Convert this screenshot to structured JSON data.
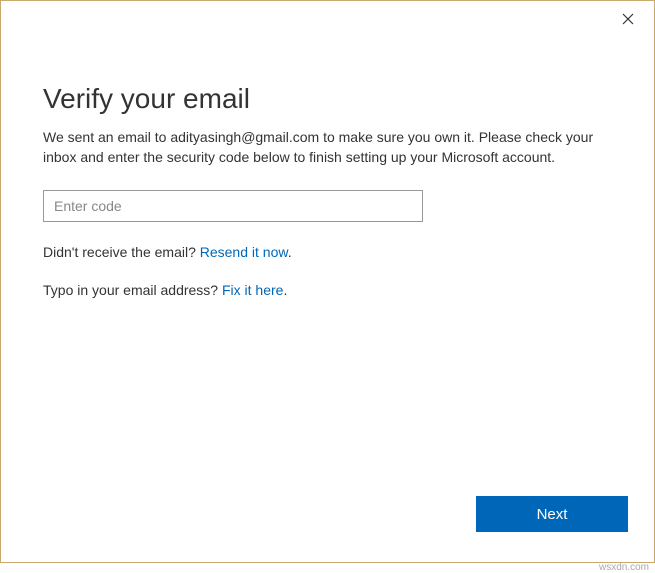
{
  "title": "Verify your email",
  "description": "We sent an email to adityasingh@gmail.com to make sure you own it. Please check your inbox and enter the security code below to finish setting up your Microsoft account.",
  "input": {
    "placeholder": "Enter code"
  },
  "resend": {
    "prefix": "Didn't receive the email? ",
    "link": "Resend it now",
    "suffix": "."
  },
  "typo": {
    "prefix": "Typo in your email address? ",
    "link": "Fix it here",
    "suffix": "."
  },
  "next_label": "Next",
  "watermark": "wsxdn.com"
}
